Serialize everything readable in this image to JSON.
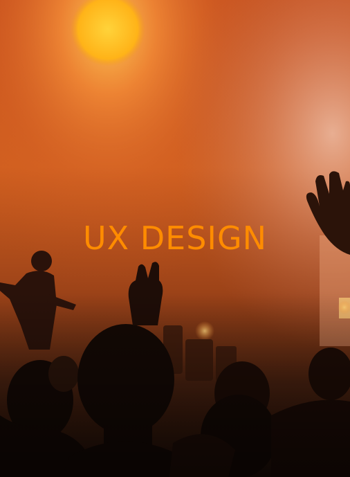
{
  "hero": {
    "headline": "UX DESIGN",
    "headline_color": "#ff8c00"
  },
  "palette": {
    "glow": "#ffb13a",
    "stage_orange": "#d2581e",
    "shadow": "#1a0d07"
  }
}
